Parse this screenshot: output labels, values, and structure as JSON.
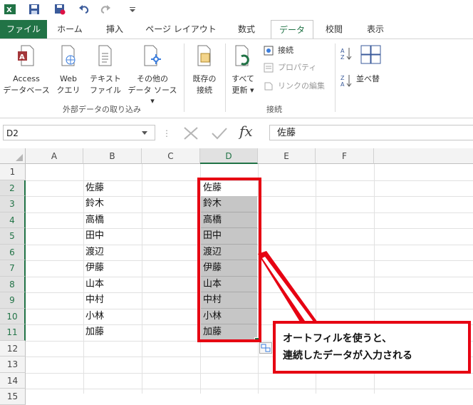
{
  "ribbon_tabs": [
    {
      "label": "ファイル"
    },
    {
      "label": "ホーム"
    },
    {
      "label": "挿入"
    },
    {
      "label": "ページ レイアウト"
    },
    {
      "label": "数式"
    },
    {
      "label": "データ"
    },
    {
      "label": "校閲"
    },
    {
      "label": "表示"
    }
  ],
  "ribbon": {
    "access": {
      "line1": "Access",
      "line2": "データベース"
    },
    "web": {
      "line1": "Web",
      "line2": "クエリ"
    },
    "text": {
      "line1": "テキスト",
      "line2": "ファイル"
    },
    "other": {
      "line1": "その他の",
      "line2": "データ ソース ▾"
    },
    "group_external": "外部データの取り込み",
    "existing": {
      "line1": "既存の",
      "line2": "接続"
    },
    "refresh": {
      "line1": "すべて",
      "line2": "更新 ▾"
    },
    "conn": "接続",
    "props": "プロパティ",
    "links": "リンクの編集",
    "group_conn": "接続",
    "sort": "並べ替"
  },
  "formula_bar": {
    "name_box": "D2",
    "fx": "fx",
    "value": "佐藤"
  },
  "columns": [
    "A",
    "B",
    "C",
    "D",
    "E",
    "F"
  ],
  "rows": [
    "1",
    "2",
    "3",
    "4",
    "5",
    "6",
    "7",
    "8",
    "9",
    "10",
    "11",
    "12",
    "13",
    "14",
    "15"
  ],
  "column_b": [
    "佐藤",
    "鈴木",
    "高橋",
    "田中",
    "渡辺",
    "伊藤",
    "山本",
    "中村",
    "小林",
    "加藤"
  ],
  "column_d": [
    "佐藤",
    "鈴木",
    "高橋",
    "田中",
    "渡辺",
    "伊藤",
    "山本",
    "中村",
    "小林",
    "加藤"
  ],
  "callout": {
    "line1": "オートフィルを使うと、",
    "line2": "連続したデータが入力される"
  },
  "colors": {
    "accent": "#217346",
    "annotation": "#e60012",
    "selection": "#c6c6c6"
  }
}
